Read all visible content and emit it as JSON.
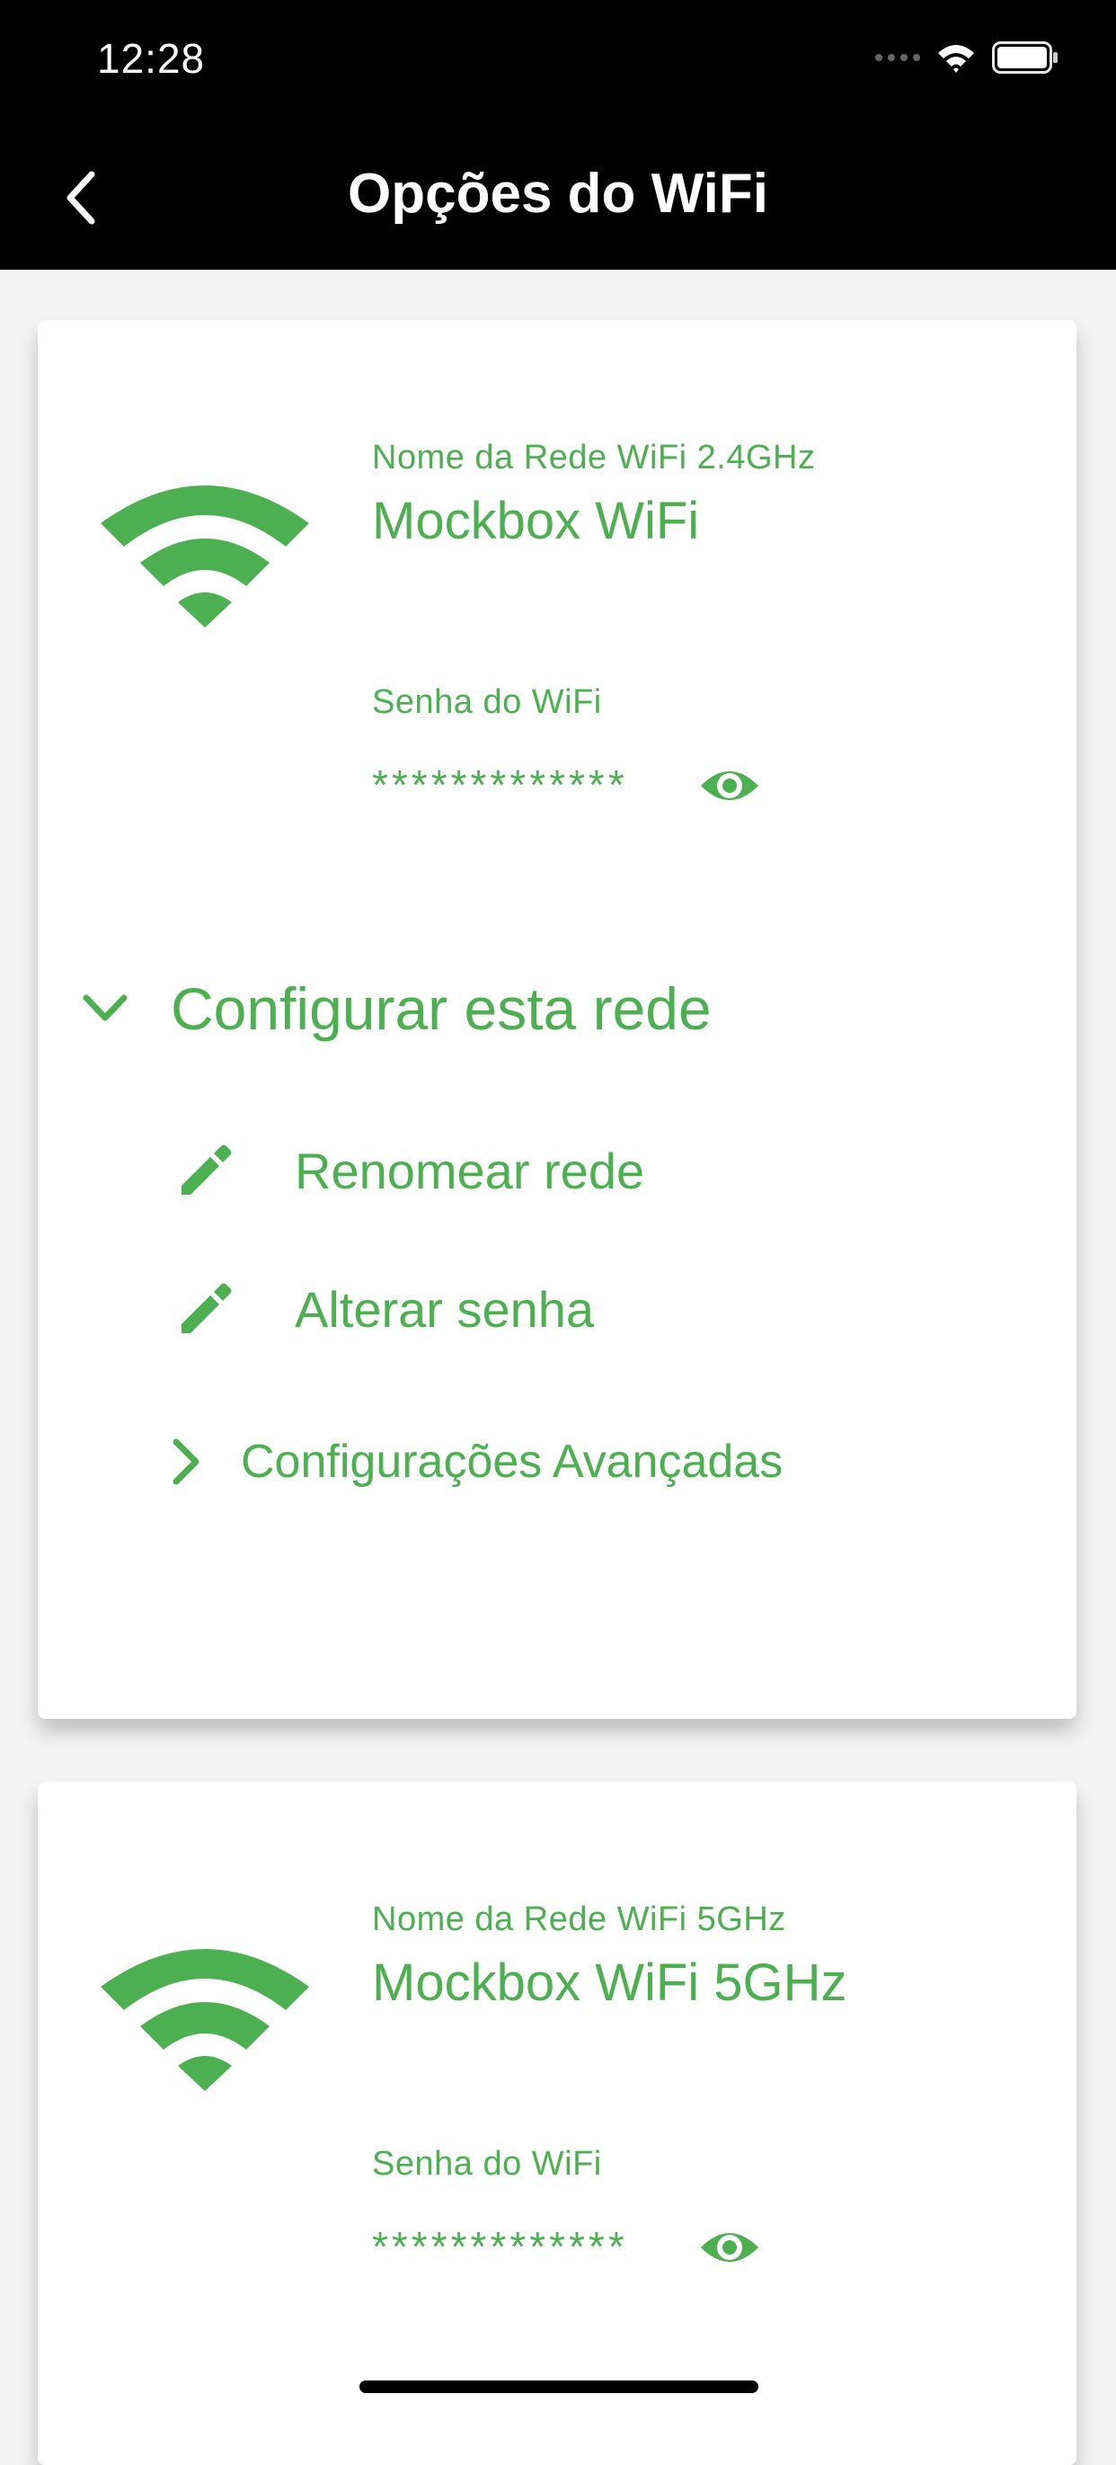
{
  "status_bar": {
    "time": "12:28"
  },
  "nav": {
    "title": "Opções do WiFi"
  },
  "networks": [
    {
      "name_label": "Nome da Rede WiFi 2.4GHz",
      "name": "Mockbox WiFi",
      "password_label": "Senha do WiFi",
      "password_masked": "*************"
    },
    {
      "name_label": "Nome da Rede WiFi 5GHz",
      "name": "Mockbox WiFi 5GHz",
      "password_label": "Senha do WiFi",
      "password_masked": "*************"
    }
  ],
  "config": {
    "section_label": "Configurar esta rede",
    "rename_label": "Renomear rede",
    "change_password_label": "Alterar senha",
    "advanced_label": "Configurações Avançadas"
  },
  "icons": {
    "back": "chevron-left-icon",
    "wifi": "wifi-icon",
    "eye": "eye-icon",
    "expand": "chevron-down-icon",
    "edit": "pencil-icon",
    "advanced": "chevron-right-icon"
  },
  "colors": {
    "accent": "#4caf50",
    "bar": "#000000",
    "background": "#f4f4f4"
  }
}
